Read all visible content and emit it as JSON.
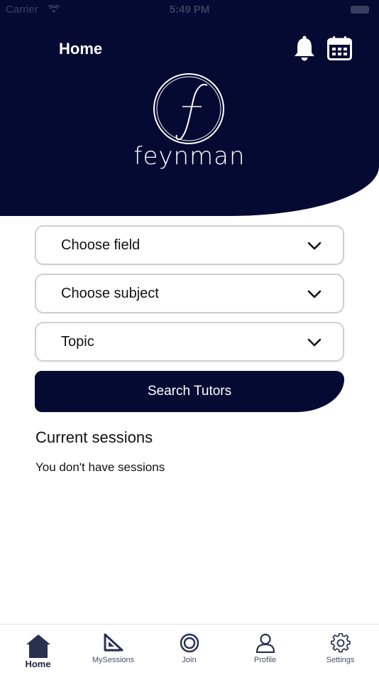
{
  "status_bar": {
    "carrier": "Carrier",
    "time": "5:49 PM"
  },
  "header": {
    "title": "Home",
    "logo_text": "feynman"
  },
  "form": {
    "field_select": "Choose field",
    "subject_select": "Choose subject",
    "topic_select": "Topic",
    "search_button": "Search Tutors"
  },
  "sessions": {
    "title": "Current sessions",
    "empty_message": "You don't have sessions"
  },
  "tabbar": {
    "items": [
      {
        "label": "Home",
        "icon": "home-icon",
        "active": true
      },
      {
        "label": "MySessions",
        "icon": "set-square-icon",
        "active": false
      },
      {
        "label": "Join",
        "icon": "target-circle-icon",
        "active": false
      },
      {
        "label": "Profile",
        "icon": "person-icon",
        "active": false
      },
      {
        "label": "Settings",
        "icon": "gear-icon",
        "active": false
      }
    ]
  },
  "colors": {
    "primary": "#050a33",
    "background": "#ffffff",
    "border": "#cfcfcf"
  }
}
